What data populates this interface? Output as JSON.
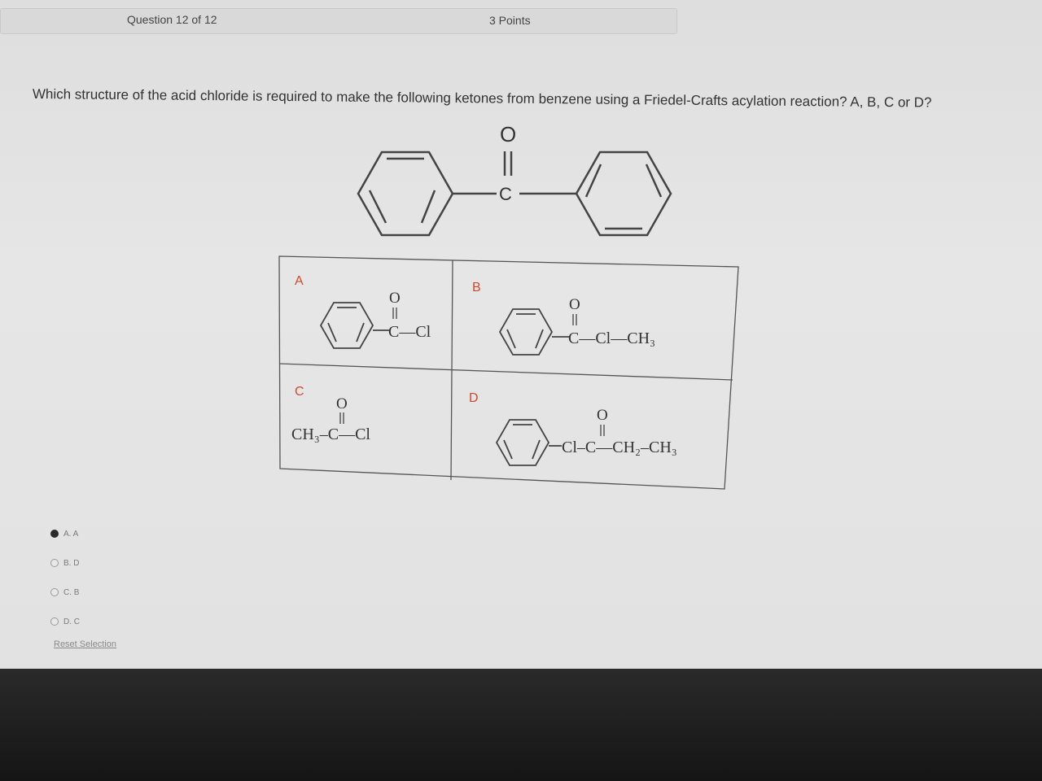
{
  "header": {
    "question_number": "Question 12 of 12",
    "points": "3 Points"
  },
  "question": {
    "text": "Which structure of the acid chloride is required to make the following ketones from benzene using a Friedel-Crafts acylation reaction? A, B, C or D?"
  },
  "target_structure": {
    "oxygen": "O",
    "carbon": "C"
  },
  "answer_grid": {
    "a": {
      "label": "A",
      "o": "O",
      "formula": "C—Cl"
    },
    "b": {
      "label": "B",
      "o": "O",
      "formula": "C—Cl—CH₃"
    },
    "c": {
      "label": "C",
      "o": "O",
      "formula": "CH₃–C—Cl"
    },
    "d": {
      "label": "D",
      "o": "O",
      "formula": "Cl–C—CH₂–CH₃"
    }
  },
  "options": [
    {
      "label": "A. A",
      "selected": true
    },
    {
      "label": "B. D",
      "selected": false
    },
    {
      "label": "C. B",
      "selected": false
    },
    {
      "label": "D. C",
      "selected": false
    }
  ],
  "reset_label": "Reset Selection"
}
